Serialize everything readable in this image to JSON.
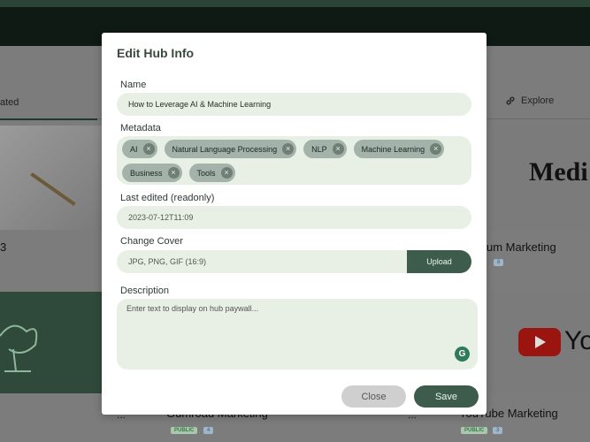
{
  "background": {
    "tab_left": "ated",
    "explore_label": "Explore",
    "medi_text": "Medi",
    "yt_text": "Yo",
    "card_title_right": "um Marketing",
    "card_title_left_frag": "3",
    "card_bottom_mid": "Gumroad Marketing",
    "card_bottom_right": "YouTube Marketing",
    "chip_public": "PUBLIC",
    "count_mid": "4",
    "count_right": "3",
    "count_top": "8",
    "dots": "..."
  },
  "modal": {
    "title": "Edit Hub Info",
    "name_label": "Name",
    "name_value": "How to Leverage AI & Machine Learning",
    "metadata_label": "Metadata",
    "tags": [
      "AI",
      "Natural Language Processing",
      "NLP",
      "Machine Learning",
      "Business",
      "Tools"
    ],
    "last_edited_label": "Last edited (readonly)",
    "last_edited_value": "2023-07-12T11:09",
    "cover_label": "Change Cover",
    "cover_placeholder": "JPG, PNG, GIF (16:9)",
    "upload_label": "Upload",
    "description_label": "Description",
    "description_placeholder": "Enter text to display on hub paywall...",
    "close_label": "Close",
    "save_label": "Save"
  },
  "colors": {
    "accent": "#3d5c4c",
    "field_bg": "#e8f0e6",
    "chip_bg": "#a3b3aa"
  }
}
